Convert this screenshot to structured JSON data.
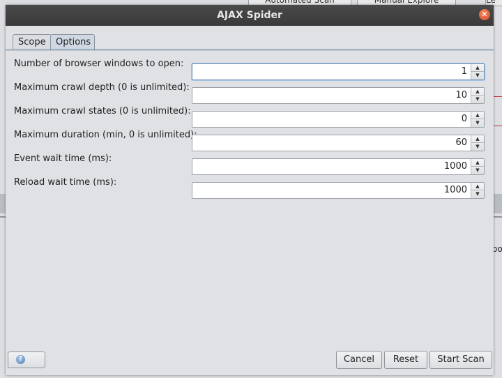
{
  "background": {
    "tabs": [
      "Automated Scan",
      "Manual Explore",
      "Le"
    ],
    "right_label": "oo"
  },
  "dialog": {
    "title": "AJAX Spider",
    "tabs": [
      {
        "label": "Scope",
        "active": false
      },
      {
        "label": "Options",
        "active": true
      }
    ],
    "fields": [
      {
        "label": "Number of browser windows to open:",
        "value": "1",
        "focused": true
      },
      {
        "label": "Maximum crawl depth (0 is unlimited):",
        "value": "10",
        "focused": false
      },
      {
        "label": "Maximum crawl states (0 is unlimited):",
        "value": "0",
        "focused": false
      },
      {
        "label": "Maximum duration (min, 0 is unlimited):",
        "value": "60",
        "focused": false
      },
      {
        "label": "Event wait time (ms):",
        "value": "1000",
        "focused": false
      },
      {
        "label": "Reload wait time (ms):",
        "value": "1000",
        "focused": false
      }
    ],
    "buttons": {
      "cancel": "Cancel",
      "reset": "Reset",
      "start_scan": "Start Scan"
    },
    "icons": {
      "close": "close-icon",
      "help": "help-icon",
      "spinner_up": "arrow-up-icon",
      "spinner_down": "arrow-down-icon"
    }
  }
}
